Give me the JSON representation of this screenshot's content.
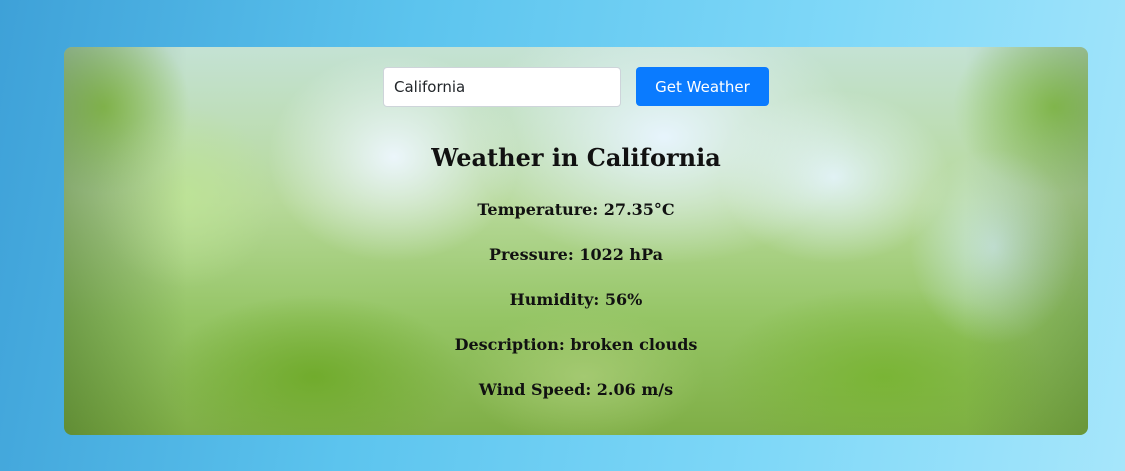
{
  "search": {
    "value": "California",
    "button_label": "Get Weather"
  },
  "weather": {
    "title": "Weather in California",
    "temperature": "Temperature: 27.35°C",
    "pressure": "Pressure: 1022 hPa",
    "humidity": "Humidity: 56%",
    "description": "Description: broken clouds",
    "wind_speed": "Wind Speed: 2.06 m/s"
  },
  "colors": {
    "button_bg": "#0a7bff",
    "page_gradient_start": "#3ea1d8",
    "page_gradient_end": "#a6e6fb"
  }
}
